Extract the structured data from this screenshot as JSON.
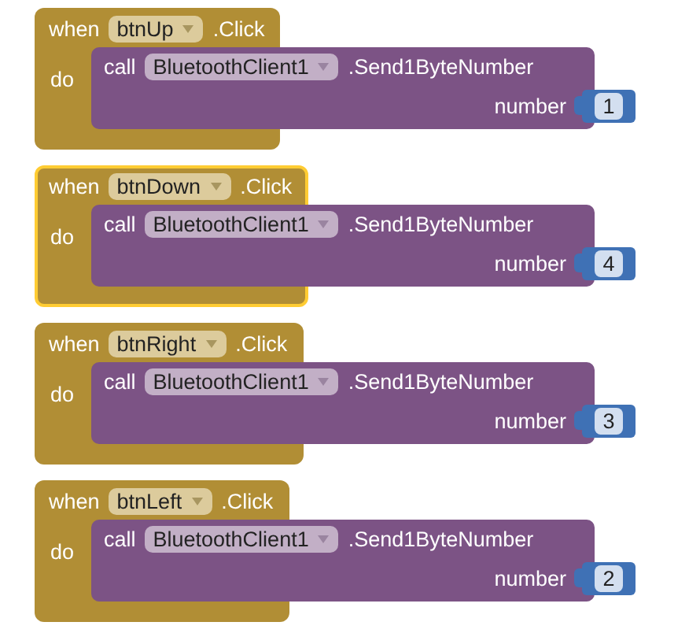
{
  "blocks": [
    {
      "selected": false,
      "when": "when",
      "component": "btnUp",
      "event": ".Click",
      "do": "do",
      "call": {
        "call": "call",
        "component": "BluetoothClient1",
        "method": ".Send1ByteNumber",
        "arg_label": "number",
        "value": "1"
      }
    },
    {
      "selected": true,
      "when": "when",
      "component": "btnDown",
      "event": ".Click",
      "do": "do",
      "call": {
        "call": "call",
        "component": "BluetoothClient1",
        "method": ".Send1ByteNumber",
        "arg_label": "number",
        "value": "4"
      }
    },
    {
      "selected": false,
      "when": "when",
      "component": "btnRight",
      "event": ".Click",
      "do": "do",
      "call": {
        "call": "call",
        "component": "BluetoothClient1",
        "method": ".Send1ByteNumber",
        "arg_label": "number",
        "value": "3"
      }
    },
    {
      "selected": false,
      "when": "when",
      "component": "btnLeft",
      "event": ".Click",
      "do": "do",
      "call": {
        "call": "call",
        "component": "BluetoothClient1",
        "method": ".Send1ByteNumber",
        "arg_label": "number",
        "value": "2"
      }
    }
  ]
}
